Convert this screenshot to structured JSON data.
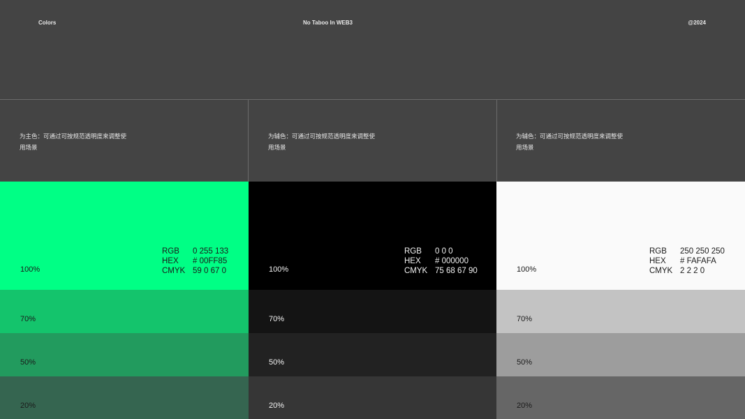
{
  "header": {
    "left": "Colors",
    "center": "No Taboo In WEB3",
    "right": "@2024"
  },
  "colors": [
    {
      "desc_line1": "为主色：可通过可按规范透明度来调整使",
      "desc_line2": "用场景",
      "rgb_label": "RGB",
      "rgb": "0 255 133",
      "hex_label": "HEX",
      "hex": "# 00FF85",
      "cmyk_label": "CMYK",
      "cmyk": "59 0 67 0",
      "tints": [
        {
          "label": "100%",
          "color": "#00FF85",
          "text": "#1a1a1a"
        },
        {
          "label": "70%",
          "color": "#14C46C",
          "text": "#1a1a1a"
        },
        {
          "label": "50%",
          "color": "#229B5E",
          "text": "#1a1a1a"
        },
        {
          "label": "20%",
          "color": "#356550",
          "text": "#1a1a1a"
        }
      ]
    },
    {
      "desc_line1": "为辅色：可通过可按规范透明度来调整使",
      "desc_line2": "用场景",
      "rgb_label": "RGB",
      "rgb": "0 0 0",
      "hex_label": "HEX",
      "hex": "# 000000",
      "cmyk_label": "CMYK",
      "cmyk": "75 68 67 90",
      "tints": [
        {
          "label": "100%",
          "color": "#000000",
          "text": "#f2f2f2"
        },
        {
          "label": "70%",
          "color": "#141414",
          "text": "#f2f2f2"
        },
        {
          "label": "50%",
          "color": "#222222",
          "text": "#f2f2f2"
        },
        {
          "label": "20%",
          "color": "#363636",
          "text": "#f2f2f2"
        }
      ]
    },
    {
      "desc_line1": "为辅色：可通过可按规范透明度来调整使",
      "desc_line2": "用场景",
      "rgb_label": "RGB",
      "rgb": "250 250 250",
      "hex_label": "HEX",
      "hex": "# FAFAFA",
      "cmyk_label": "CMYK",
      "cmyk": "2 2 2 0",
      "tints": [
        {
          "label": "100%",
          "color": "#FAFAFA",
          "text": "#1a1a1a"
        },
        {
          "label": "70%",
          "color": "#C3C3C3",
          "text": "#1a1a1a"
        },
        {
          "label": "50%",
          "color": "#9D9D9D",
          "text": "#1a1a1a"
        },
        {
          "label": "20%",
          "color": "#666666",
          "text": "#1a1a1a"
        }
      ]
    }
  ]
}
